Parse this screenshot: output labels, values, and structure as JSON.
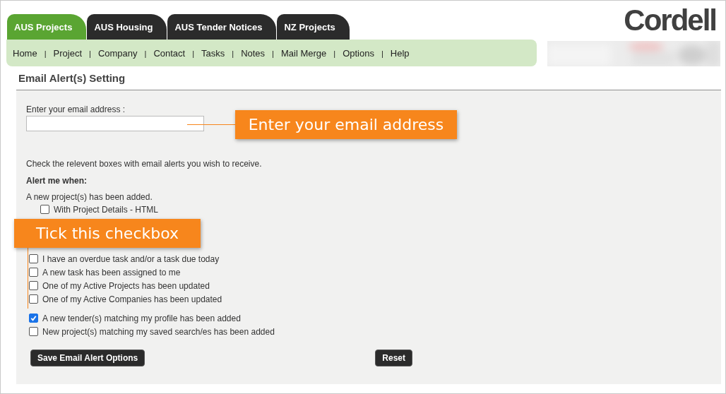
{
  "tabs": [
    {
      "label": "AUS Projects",
      "selected": true
    },
    {
      "label": "AUS Housing",
      "selected": false
    },
    {
      "label": "AUS Tender Notices",
      "selected": false
    },
    {
      "label": "NZ Projects",
      "selected": false
    }
  ],
  "logo": "Cordell",
  "nav": [
    "Home",
    "Project",
    "Company",
    "Contact",
    "Tasks",
    "Notes",
    "Mail Merge",
    "Options",
    "Help"
  ],
  "nav_separator": "|",
  "page_title": "Email Alert(s) Setting",
  "email": {
    "label": "Enter your email address :"
  },
  "instructions": "Check the relevent boxes with email alerts you wish to receive.",
  "alert_heading": "Alert me when:",
  "new_project": {
    "label": "A new project(s) has been added.",
    "options": [
      {
        "label": "With Project Details - HTML",
        "checked": false
      }
    ]
  },
  "alerts": [
    {
      "label": "I have an overdue task and/or a task due today",
      "checked": false
    },
    {
      "label": "A new task has been assigned to me",
      "checked": false
    },
    {
      "label": "One of my Active Projects has been updated",
      "checked": false
    },
    {
      "label": "One of my Active Companies has been updated",
      "checked": false
    }
  ],
  "profile_alerts": [
    {
      "label": "A new tender(s) matching my profile has been added",
      "checked": true
    },
    {
      "label": "New project(s) matching my saved search/es has been added",
      "checked": false
    }
  ],
  "buttons": [
    "Save Email Alert Options",
    "Reset"
  ],
  "callouts": [
    "Enter your email address",
    "Tick this checkbox"
  ]
}
